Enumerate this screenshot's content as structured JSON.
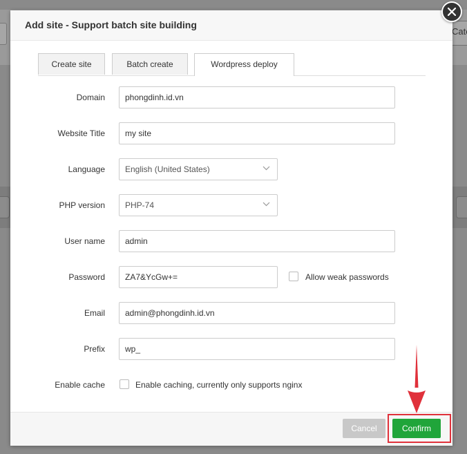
{
  "background": {
    "right_text": "Categ"
  },
  "modal": {
    "title": "Add site - Support batch site building",
    "tabs": [
      {
        "label": "Create site",
        "active": false
      },
      {
        "label": "Batch create",
        "active": false
      },
      {
        "label": "Wordpress deploy",
        "active": true
      }
    ],
    "form": {
      "domain": {
        "label": "Domain",
        "value": "phongdinh.id.vn"
      },
      "website_title": {
        "label": "Website Title",
        "value": "my site"
      },
      "language": {
        "label": "Language",
        "value": "English (United States)"
      },
      "php_version": {
        "label": "PHP version",
        "value": "PHP-74"
      },
      "user_name": {
        "label": "User name",
        "value": "admin"
      },
      "password": {
        "label": "Password",
        "value": "ZA7&YcGw+=",
        "weak_label": "Allow weak passwords",
        "weak_checked": false
      },
      "email": {
        "label": "Email",
        "value": "admin@phongdinh.id.vn"
      },
      "prefix": {
        "label": "Prefix",
        "value": "wp_"
      },
      "enable_cache": {
        "label": "Enable cache",
        "checkbox_label": "Enable caching, currently only supports nginx",
        "checked": false
      }
    },
    "footer": {
      "cancel_label": "Cancel",
      "confirm_label": "Confirm"
    }
  },
  "colors": {
    "confirm": "#20a53a",
    "cancel": "#c8c8c8",
    "annotation": "#e0313b",
    "close": "#333333"
  },
  "icons": {
    "close": "close-icon",
    "chevron": "chevron-down-icon",
    "arrow": "red-arrow-annotation"
  }
}
